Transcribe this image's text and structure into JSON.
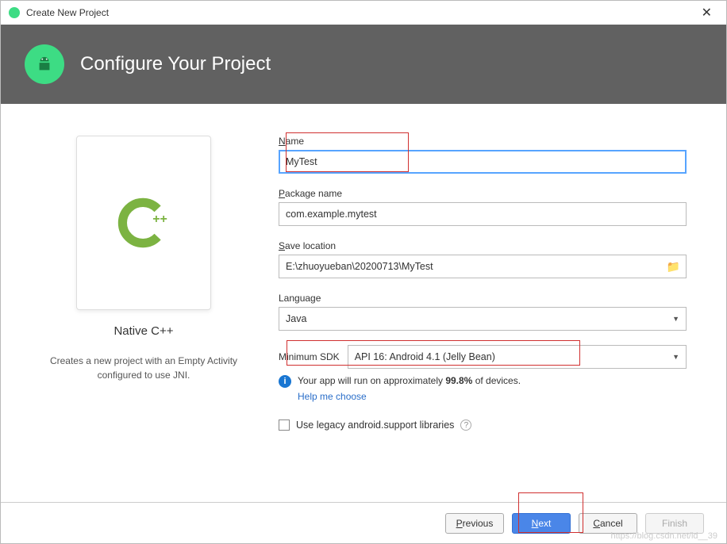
{
  "titlebar": {
    "title": "Create New Project"
  },
  "header": {
    "title": "Configure Your Project"
  },
  "template": {
    "title": "Native C++",
    "desc": "Creates a new project with an Empty Activity configured to use JNI."
  },
  "form": {
    "name_label": "Name",
    "name_value": "MyTest",
    "package_label": "Package name",
    "package_value": "com.example.mytest",
    "location_label": "Save location",
    "location_value": "E:\\zhuoyueban\\20200713\\MyTest",
    "language_label": "Language",
    "language_value": "Java",
    "sdk_label": "Minimum SDK",
    "sdk_value": "API 16: Android 4.1 (Jelly Bean)",
    "hint_pre": "Your app will run on approximately ",
    "hint_pct": "99.8%",
    "hint_post": " of devices.",
    "help_link": "Help me choose",
    "legacy_label": "Use legacy android.support libraries"
  },
  "footer": {
    "previous": "Previous",
    "next": "Next",
    "cancel": "Cancel",
    "finish": "Finish"
  },
  "watermark": "https://blog.csdn.net/id__39"
}
